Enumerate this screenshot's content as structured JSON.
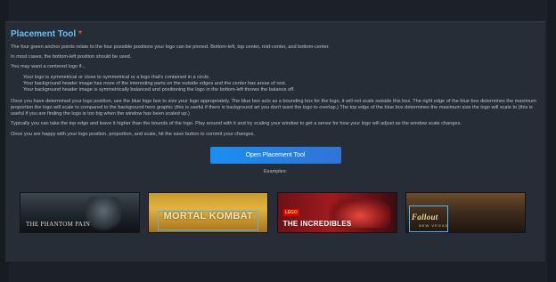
{
  "panel": {
    "title": "Placement Tool",
    "required_mark": "*",
    "paragraphs": [
      "The four green anchor points relate to the four possible positions your logo can be pinned. Bottom-left, top center, mid-center, and bottom-center.",
      "In most cases, the bottom-left position should be used.",
      "You may want a centered logo if..."
    ],
    "bullets": [
      "Your logo is symmetrical or close to symmetrical or a logo that's contained in a circle.",
      "Your background header image has more of the interesting parts on the outside edges and the center has areas of rest.",
      "Your background header image is symmetrically balanced and positioning the logo in the bottom-left throws the balance off."
    ],
    "paragraphs_after": [
      "Once you have determined your logo position, use the blue logo box to size your logo appropriately. The blue box acts as a bounding box for the logo, it will not scale outside this box. The right edge of the blue box determines the maximum proportion the logo will scale to compared to the background hero graphic (this is useful if there is background art you don't want the logo to overlap.) The top edge of the blue box determines the maximum size the logo will scale to (this is useful if you are finding the logo is too big when the window has been scaled up.)",
      "Typically you can take the top edge and leave it higher than the bounds of the logo. Play around with it and try scaling your window to get a sense for how your logo will adjust as the window scale changes.",
      "Once you are happy with your logo position, proportion, and scale, hit the save button to commit your changes."
    ],
    "button_label": "Open Placement Tool",
    "examples_label": "Examples:"
  },
  "examples": [
    {
      "logo": "THE PHANTOM PAIN",
      "icon": "phantom-pain-hero-image"
    },
    {
      "logo": "MORTAL KOMBAT",
      "icon": "mortal-kombat-hero-image"
    },
    {
      "logo": "THE INCREDIBLES",
      "badge": "LEGO",
      "icon": "lego-incredibles-hero-image"
    },
    {
      "logo": "Fallout",
      "sub": "NEW VEGAS",
      "icon": "fallout-new-vegas-hero-image"
    }
  ],
  "colors": {
    "title": "#67c1f5",
    "required": "#e55b4d",
    "button_start": "#1a8ff0",
    "button_end": "#2f74d8",
    "panel_bg": "#272d37",
    "page_bg": "#1b2029",
    "anchor_box": "#4fb3ff"
  }
}
